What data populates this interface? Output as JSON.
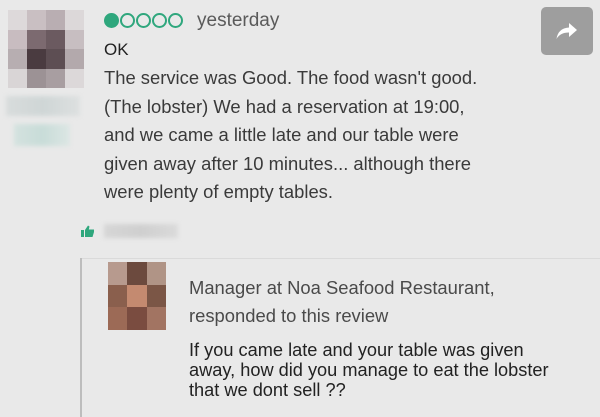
{
  "review": {
    "rating": {
      "score": 1,
      "max": 5
    },
    "date": "yesterday",
    "title": "OK",
    "body_lines": [
      "The service was Good. The food wasn't good.",
      "(The lobster) We had a reservation at 19:00,",
      "and we came a little late and our table were",
      "given away after 10 minutes... although there",
      "were plenty of empty tables."
    ]
  },
  "share": {
    "icon": "share-arrow-icon"
  },
  "helpful": {
    "icon": "thumbs-up-icon"
  },
  "response": {
    "author_line": "Manager at Noa Seafood Restaurant,",
    "responded_line": "responded to this review",
    "body_lines": [
      "If you came late and your table was given",
      "away, how did you manage to eat the lobster",
      "that we dont sell ??"
    ]
  },
  "colors": {
    "rating_green": "#2fa77d",
    "share_button_bg": "#9e9e9e",
    "page_bg": "#e9e9e9"
  }
}
